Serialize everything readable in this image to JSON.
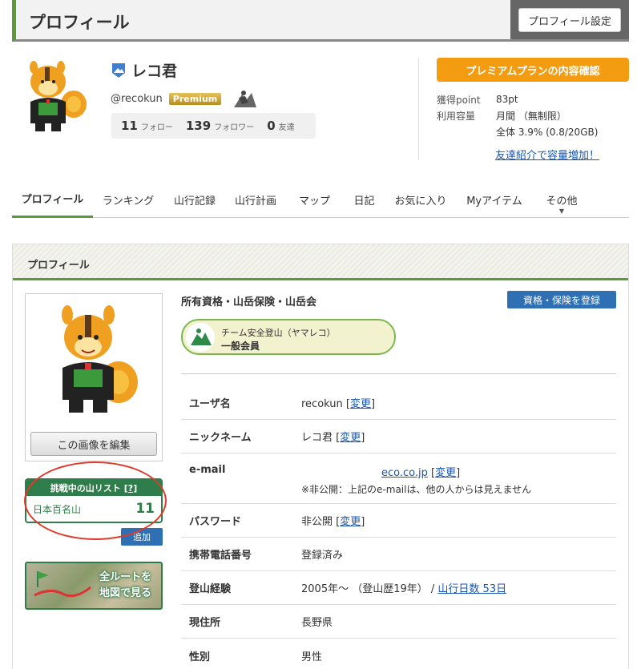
{
  "header": {
    "title": "プロフィール",
    "settings_label": "プロフィール設定"
  },
  "user": {
    "nickname": "レコ君",
    "handle": "@recokun",
    "premium_label": "Premium",
    "follow_count": "11",
    "follow_label": "フォロー",
    "follower_count": "139",
    "follower_label": "フォロワー",
    "friend_count": "0",
    "friend_label": "友達"
  },
  "account": {
    "premium_button": "プレミアムプランの内容確認",
    "points_label": "獲得point",
    "points_value": "83pt",
    "capacity_label": "利用容量",
    "capacity_monthly": "月間 （無制限）",
    "capacity_total": "全体 3.9% (0.8/20GB)",
    "referral_link": "友達紹介で容量増加！"
  },
  "nav": {
    "tabs": [
      {
        "label": "プロフィール"
      },
      {
        "label": "ランキング"
      },
      {
        "label": "山行記録"
      },
      {
        "label": "山行計画"
      },
      {
        "label": "マップ"
      },
      {
        "label": "日記"
      },
      {
        "label": "お気に入り"
      },
      {
        "label": "Myアイテム"
      },
      {
        "label": "その他"
      }
    ]
  },
  "panel": {
    "title": "プロフィール",
    "edit_image": "この画像を編集",
    "challenge_list_title": "挑戦中の山リスト",
    "challenge_help": "[?]",
    "challenge_item": "日本百名山",
    "challenge_count": "11",
    "add_label": "追加",
    "map_line1": "全ルートを",
    "map_line2": "地図で見る",
    "qual_title": "所有資格・山岳保険・山岳会",
    "qual_button": "資格・保険を登録",
    "team_name": "チーム安全登山（ヤマレコ）",
    "team_role": "一般会員",
    "change_label": "変更",
    "rows": {
      "username_label": "ユーザ名",
      "username_value": "recokun",
      "nickname_label": "ニックネーム",
      "nickname_value": "レコ君",
      "email_label": "e-mail",
      "email_value": "eco.co.jp",
      "email_note": "※非公開：上記のe-mailは、他の人からは見えません",
      "password_label": "パスワード",
      "password_value": "非公開",
      "phone_label": "携帯電話番号",
      "phone_value": "登録済み",
      "experience_label": "登山経験",
      "experience_value": "2005年〜 （登山歴19年）",
      "experience_link": "山行日数 53日",
      "residence_label": "現住所",
      "residence_value": "長野県",
      "gender_label": "性別",
      "gender_value": "男性"
    }
  }
}
